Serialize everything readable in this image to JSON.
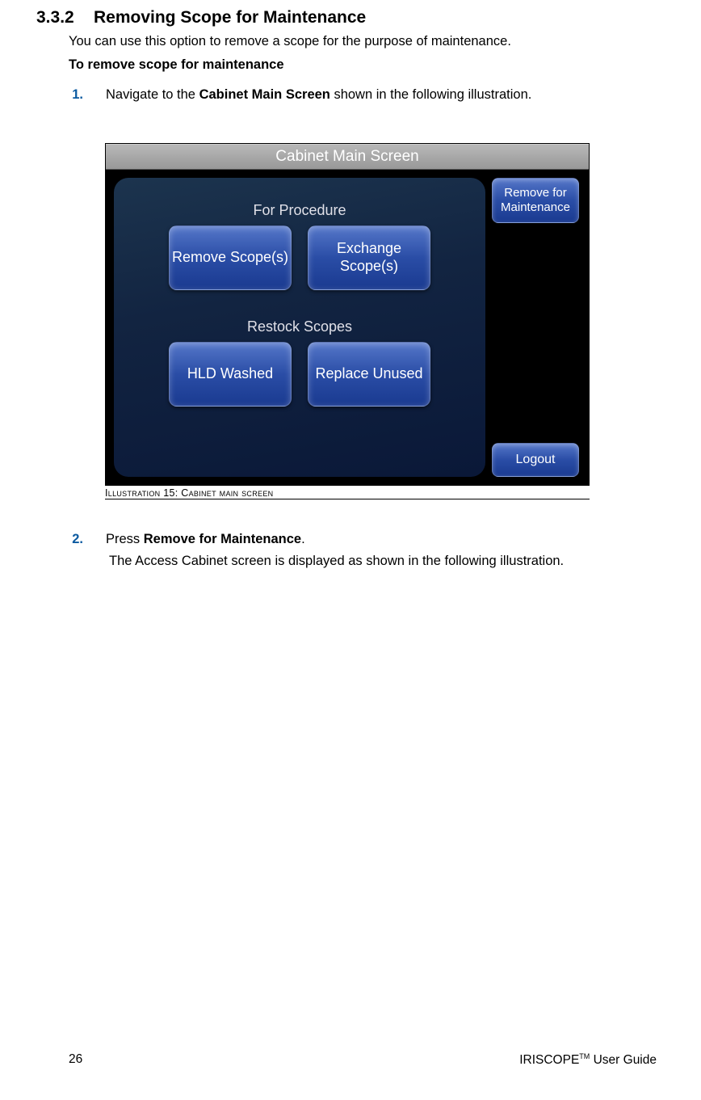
{
  "section": {
    "number": "3.3.2",
    "title": "Removing Scope for Maintenance"
  },
  "intro": "You can use this option to remove a scope for the purpose of maintenance.",
  "subheading": "To remove scope for maintenance",
  "steps": {
    "s1": {
      "num": "1.",
      "prefix": "Navigate to the ",
      "bold": "Cabinet Main Screen",
      "suffix": " shown in the following illustration."
    },
    "s2": {
      "num": "2.",
      "prefix": "Press ",
      "bold": "Remove for Maintenance",
      "suffix": "."
    },
    "after2_prefix": "The ",
    "after2_bold": "Access Cabinet",
    "after2_suffix": " screen is displayed as shown in the following illustration."
  },
  "screenshot": {
    "title": "Cabinet Main Screen",
    "group1_label": "For Procedure",
    "btn_remove_scopes": "Remove Scope(s)",
    "btn_exchange_scopes": "Exchange Scope(s)",
    "group2_label": "Restock Scopes",
    "btn_hld_washed": "HLD Washed",
    "btn_replace_unused": "Replace Unused",
    "btn_remove_maintenance": "Remove for Maintenance",
    "btn_logout": "Logout"
  },
  "caption": "Illustration 15: Cabinet main screen",
  "footer": {
    "page": "26",
    "guide_prefix": "IRISCOPE",
    "guide_suffix": " User Guide",
    "tm": "TM"
  }
}
